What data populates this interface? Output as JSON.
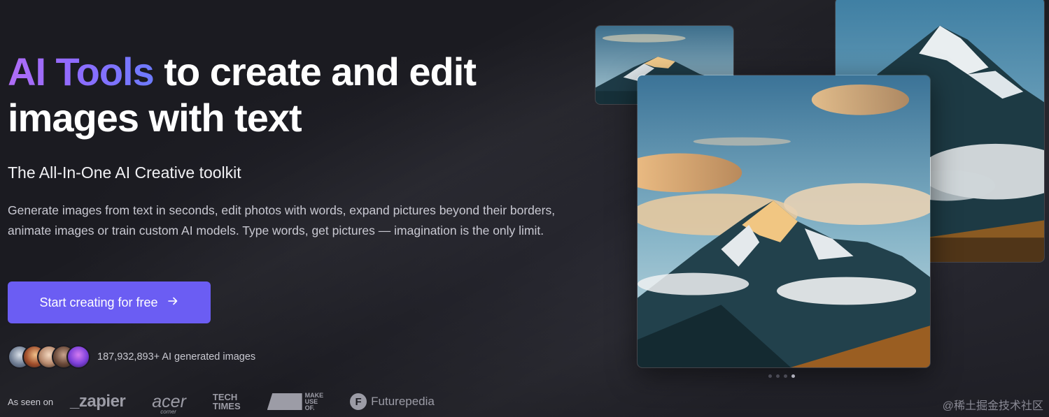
{
  "hero": {
    "headline_accent": "AI Tools",
    "headline_rest": " to create and edit images with text",
    "subtitle": "The All-In-One AI Creative toolkit",
    "description": "Generate images from text in seconds, edit photos with words, expand pictures beyond their borders, animate images or train custom AI models. Type words, get pictures — imagination is the only limit.",
    "cta_label": "Start creating for free",
    "cta_icon": "arrow-right-icon"
  },
  "social_proof": {
    "count_text": "187,932,893+ AI generated images",
    "avatar_count": 5
  },
  "seen_on": {
    "label": "As seen on",
    "logos": {
      "zapier": "_zapier",
      "acer": "acer",
      "acer_sub": "corner",
      "tech_top": "TECH",
      "tech_bottom": "TIMES",
      "makeuse_1": "MAKE",
      "makeuse_2": "USE",
      "makeuse_3": "OF.",
      "futurepedia_icon": "F",
      "futurepedia": "Futurepedia"
    }
  },
  "carousel": {
    "slides": 4,
    "active_index": 3
  },
  "watermark": "@稀土掘金技术社区",
  "colors": {
    "background": "#1b1b21",
    "accent_button": "#6b5df3",
    "gradient_start": "#b06cf5",
    "gradient_end": "#6d7bff"
  }
}
